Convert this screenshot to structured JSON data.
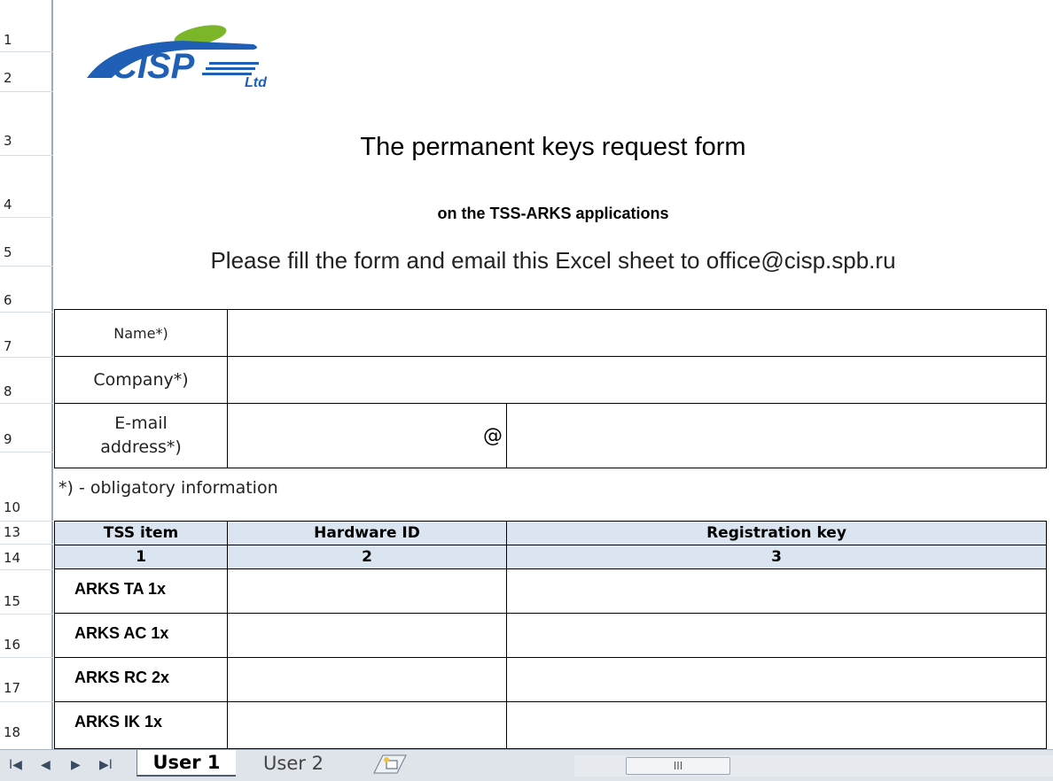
{
  "rows": [
    "1",
    "2",
    "3",
    "4",
    "5",
    "6",
    "7",
    "8",
    "9",
    "10",
    "13",
    "14",
    "15",
    "16",
    "17",
    "18"
  ],
  "logo_text": "CISP Ltd",
  "sheet": {
    "title": "The permanent keys request form",
    "subtitle": "on the TSS-ARKS applications",
    "instruction": "Please fill the form and email this Excel sheet to office@cisp.spb.ru"
  },
  "form": {
    "name_label": "Name*)",
    "company_label": "Company*)",
    "email_label_line1": "E-mail",
    "email_label_line2": "address*)",
    "at_sign": "@",
    "note": "*) - obligatory information"
  },
  "table": {
    "headers": [
      "TSS item",
      "Hardware ID",
      "Registration key"
    ],
    "col_numbers": [
      "1",
      "2",
      "3"
    ],
    "items": [
      "ARKS TA 1x",
      "ARKS AC 1x",
      "ARKS RC 2x",
      "ARKS IK 1x"
    ]
  },
  "tabs": {
    "nav": [
      "I◀",
      "◀",
      "▶",
      "▶I"
    ],
    "active": "User 1",
    "inactive": "User 2",
    "scroll_grip": "III"
  },
  "colors": {
    "header_fill": "#dbe5f1",
    "logo_blue": "#1f5fb5",
    "logo_green": "#7ab52a"
  }
}
